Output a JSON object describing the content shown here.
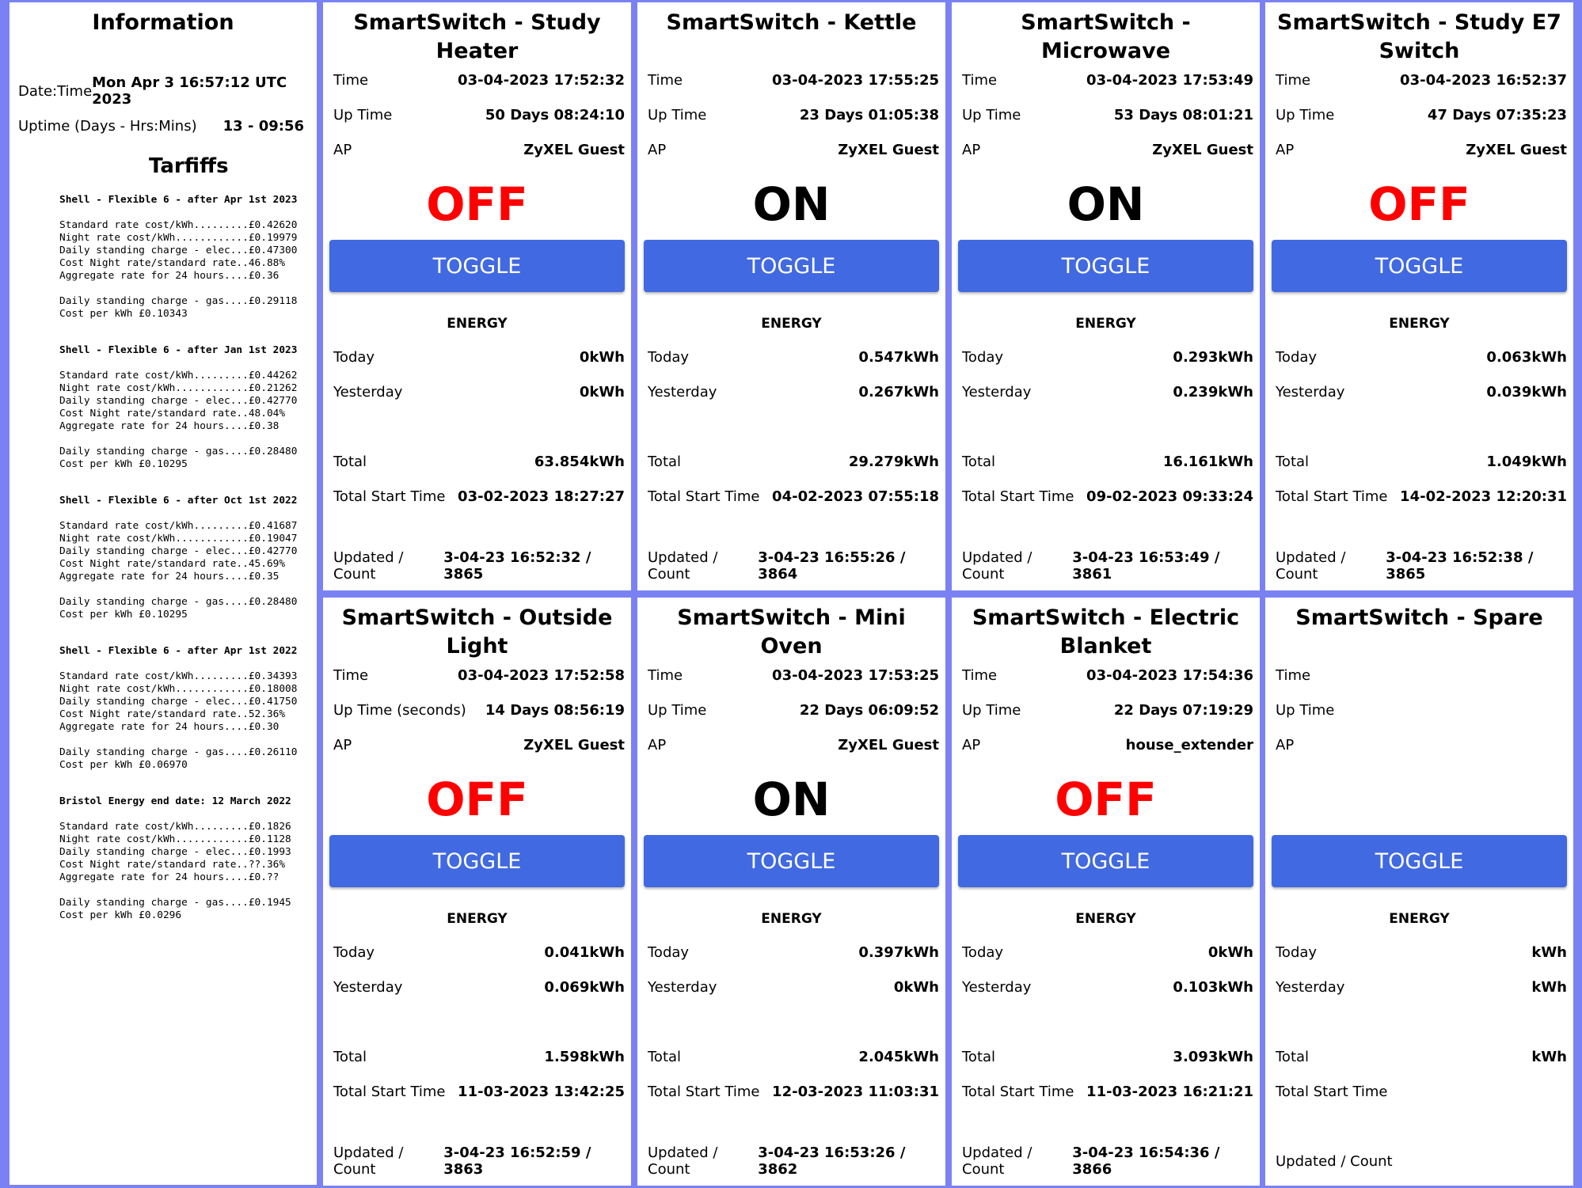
{
  "info": {
    "title": "Information",
    "rows": [
      {
        "label": "Date:Time",
        "value": "Mon Apr 3 16:57:12 UTC 2023"
      },
      {
        "label": "Uptime (Days - Hrs:Mins)",
        "value": "13 - 09:56"
      }
    ],
    "tariffs_title": "Tarfiffs",
    "tariffs": [
      {
        "head": "Shell - Flexible 6 - after Apr 1st 2023",
        "lines": "Standard rate cost/kWh.........£0.42620\nNight rate cost/kWh............£0.19979\nDaily standing charge - elec...£0.47300\nCost Night rate/standard rate..46.88%\nAggregate rate for 24 hours....£0.36",
        "gas": "Daily standing charge - gas....£0.29118\nCost per kWh £0.10343"
      },
      {
        "head": "Shell - Flexible 6 - after Jan 1st 2023",
        "lines": "Standard rate cost/kWh.........£0.44262\nNight rate cost/kWh............£0.21262\nDaily standing charge - elec...£0.42770\nCost Night rate/standard rate..48.04%\nAggregate rate for 24 hours....£0.38",
        "gas": "Daily standing charge - gas....£0.28480\nCost per kWh £0.10295"
      },
      {
        "head": "Shell - Flexible 6 - after Oct 1st 2022",
        "lines": "Standard rate cost/kWh.........£0.41687\nNight rate cost/kWh............£0.19047\nDaily standing charge - elec...£0.42770\nCost Night rate/standard rate..45.69%\nAggregate rate for 24 hours....£0.35",
        "gas": "Daily standing charge - gas....£0.28480\nCost per kWh £0.10295"
      },
      {
        "head": "Shell - Flexible 6 - after Apr 1st 2022",
        "lines": "Standard rate cost/kWh.........£0.34393\nNight rate cost/kWh............£0.18008\nDaily standing charge - elec...£0.41750\nCost Night rate/standard rate..52.36%\nAggregate rate for 24 hours....£0.30",
        "gas": "Daily standing charge - gas....£0.26110\nCost per kWh £0.06970"
      },
      {
        "head": "Bristol Energy end date: 12 March 2022",
        "lines": "Standard rate cost/kWh.........£0.1826\nNight rate cost/kWh............£0.1128\nDaily standing charge - elec...£0.1993\nCost Night rate/standard rate..??.36%\nAggregate rate for 24 hours....£0.??",
        "gas": "Daily standing charge - gas....£0.1945\nCost per kWh £0.0296"
      }
    ]
  },
  "labels": {
    "time": "Time",
    "uptime": "Up Time",
    "uptime_seconds": "Up Time (seconds)",
    "ap": "AP",
    "toggle": "TOGGLE",
    "energy": "ENERGY",
    "today": "Today",
    "yesterday": "Yesterday",
    "total": "Total",
    "total_start": "Total Start Time",
    "updated": "Updated / Count"
  },
  "colors": {
    "background": "#7a82f3",
    "toggle": "#4169e1",
    "off": "#ff0000",
    "on": "#000000"
  },
  "cards": [
    {
      "title": "SmartSwitch - Study Heater",
      "time": "03-04-2023 17:52:32",
      "uptime_label": "Up Time",
      "uptime": "50 Days 08:24:10",
      "ap": "ZyXEL Guest",
      "state": "OFF",
      "today": "0kWh",
      "yesterday": "0kWh",
      "total": "63.854kWh",
      "total_start": "03-02-2023 18:27:27",
      "updated": "3-04-23 16:52:32 / 3865"
    },
    {
      "title": "SmartSwitch - Kettle",
      "time": "03-04-2023 17:55:25",
      "uptime_label": "Up Time",
      "uptime": "23 Days 01:05:38",
      "ap": "ZyXEL Guest",
      "state": "ON",
      "today": "0.547kWh",
      "yesterday": "0.267kWh",
      "total": "29.279kWh",
      "total_start": "04-02-2023 07:55:18",
      "updated": "3-04-23 16:55:26 / 3864"
    },
    {
      "title": "SmartSwitch - Microwave",
      "time": "03-04-2023 17:53:49",
      "uptime_label": "Up Time",
      "uptime": "53 Days 08:01:21",
      "ap": "ZyXEL Guest",
      "state": "ON",
      "today": "0.293kWh",
      "yesterday": "0.239kWh",
      "total": "16.161kWh",
      "total_start": "09-02-2023 09:33:24",
      "updated": "3-04-23 16:53:49 / 3861"
    },
    {
      "title": "SmartSwitch - Study E7 Switch",
      "time": "03-04-2023 16:52:37",
      "uptime_label": "Up Time",
      "uptime": "47 Days 07:35:23",
      "ap": "ZyXEL Guest",
      "state": "OFF",
      "today": "0.063kWh",
      "yesterday": "0.039kWh",
      "total": "1.049kWh",
      "total_start": "14-02-2023 12:20:31",
      "updated": "3-04-23 16:52:38 / 3865"
    },
    {
      "title": "SmartSwitch - Outside Light",
      "time": "03-04-2023 17:52:58",
      "uptime_label": "Up Time (seconds)",
      "uptime": "14 Days 08:56:19",
      "ap": "ZyXEL Guest",
      "state": "OFF",
      "today": "0.041kWh",
      "yesterday": "0.069kWh",
      "total": "1.598kWh",
      "total_start": "11-03-2023 13:42:25",
      "updated": "3-04-23 16:52:59 / 3863"
    },
    {
      "title": "SmartSwitch - Mini Oven",
      "time": "03-04-2023 17:53:25",
      "uptime_label": "Up Time",
      "uptime": "22 Days 06:09:52",
      "ap": "ZyXEL Guest",
      "state": "ON",
      "today": "0.397kWh",
      "yesterday": "0kWh",
      "total": "2.045kWh",
      "total_start": "12-03-2023 11:03:31",
      "updated": "3-04-23 16:53:26 / 3862"
    },
    {
      "title": "SmartSwitch - Electric Blanket",
      "time": "03-04-2023 17:54:36",
      "uptime_label": "Up Time",
      "uptime": "22 Days 07:19:29",
      "ap": "house_extender",
      "state": "OFF",
      "today": "0kWh",
      "yesterday": "0.103kWh",
      "total": "3.093kWh",
      "total_start": "11-03-2023 16:21:21",
      "updated": "3-04-23 16:54:36 / 3866"
    },
    {
      "title": "SmartSwitch - Spare",
      "time": "",
      "uptime_label": "Up Time",
      "uptime": "",
      "ap": "",
      "state": "",
      "today": "kWh",
      "yesterday": "kWh",
      "total": "kWh",
      "total_start": "",
      "updated": ""
    }
  ]
}
